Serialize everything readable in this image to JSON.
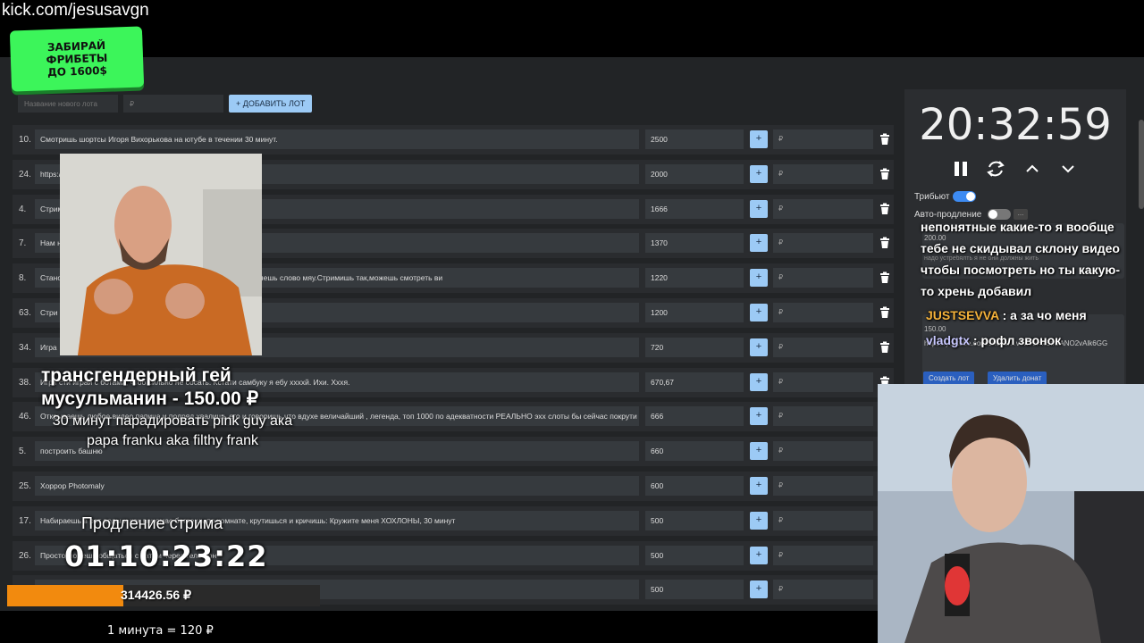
{
  "stream": {
    "url": "kick.com/jesusavgn"
  },
  "promo": {
    "text": "ЗАБИРАЙ\nФРИБЕТЫ\nДО 1600$"
  },
  "add_lot": {
    "name_placeholder": "Название нового лота",
    "price_placeholder": "₽",
    "button_label": "+ ДОБАВИТЬ ЛОТ"
  },
  "lots": [
    {
      "num": "10.",
      "name": "Смотришь шортсы Игоря Вихорькова на ютубе в течении 30 минут.",
      "amount": "2500",
      "rub": "₽"
    },
    {
      "num": "24.",
      "name": "https://",
      "amount": "2000",
      "rub": "₽"
    },
    {
      "num": "4.",
      "name": "Стрими",
      "amount": "1666",
      "rub": "₽"
    },
    {
      "num": "7.",
      "name": "Нам ну",
      "amount": "1370",
      "rub": "₽"
    },
    {
      "num": "8.",
      "name": "Станов                                                                             вку и перед каждым или в конце предложения добавляешь слово мяу.Стримишь так,можешь смотреть ви",
      "amount": "1220",
      "rub": "₽"
    },
    {
      "num": "63.",
      "name": "Стри                                                                              к можешь, приговаривая глянь‌те на мою прелесть",
      "amount": "1200",
      "rub": "₽"
    },
    {
      "num": "34.",
      "name": "Игра",
      "amount": "720",
      "rub": "₽"
    },
    {
      "num": "38.",
      "name": "Игрн                                                                              сти играй с ботами, чтоб сильно не сосать. Кстати самбуку я ебу ххххй. Ихи. Хххя.",
      "amount": "670,67",
      "rub": "₽"
    },
    {
      "num": "46.",
      "name": "Открываешь любое видео папича и подряд хвалишь его и говоришь что вдухе величайший , легенда, топ 1000 по адекватности РЕАЛЬНО эхх слоты бы сейчас покрути",
      "amount": "666",
      "rub": "₽"
    },
    {
      "num": "5.",
      "name": "построить башню",
      "amount": "660",
      "rub": "₽"
    },
    {
      "num": "25.",
      "name": "Хоррор Photomaly",
      "amount": "600",
      "rub": "₽"
    },
    {
      "num": "17.",
      "name": "Набираешь в рот воды и как ваномас бегаешь по комнате, крутишься и кричишь: Кружите меня ХОХЛОНЫ, 30 минут",
      "amount": "500",
      "rub": "₽"
    },
    {
      "num": "26.",
      "name": "Просто                                                               можешь общаться с чатом через телефон",
      "amount": "500",
      "rub": "₽"
    },
    {
      "num": "",
      "name": "                                                                                       ите этот завоз WW)",
      "amount": "500",
      "rub": "₽"
    }
  ],
  "timer": {
    "display": "20:32:59",
    "tribute_label": "Трибьют",
    "autoextend_label": "Авто-продление",
    "more_label": "..."
  },
  "side_lots": {
    "card1_amount": "200.00",
    "card1_text": "надо устребялть я не они должны жить",
    "card2_amount": "150.00",
    "card2_text": "https://youtube.com/shorts/...vTw?si=xStIUANO2vAlk6GG",
    "create_button": "Создать лот",
    "delete_button": "Удалить донат"
  },
  "chat": {
    "line1": "непонятные какие-то я вообще",
    "line2": "тебе не скидывал склону видео",
    "line3": "чтобы посмотреть но ты какую-",
    "line4": "то хрень добавил",
    "msg1_nick": "JUSTSEVVA",
    "msg1_text": " : а за чо меня",
    "msg2_nick": "vladgtx",
    "msg2_text": " : рофл звонок"
  },
  "alert": {
    "title": "трансгендерный гей\nмусульманин - 150.00 ₽",
    "message": "30 минут парадировать pink guy ака\npapa franku aka filthy frank"
  },
  "extension": {
    "label": "Продление стрима",
    "time": "01:10:23:22"
  },
  "progress": {
    "fraction": 0.37,
    "amount": "314426.56 ₽"
  },
  "rate": "1 минута = 120 ₽",
  "colors": {
    "accent": "#9ccaf5",
    "promo": "#3cf55a",
    "progress": "#f28a0e",
    "nick": "#f5b23a",
    "toggle_on": "#3d8bf2"
  }
}
